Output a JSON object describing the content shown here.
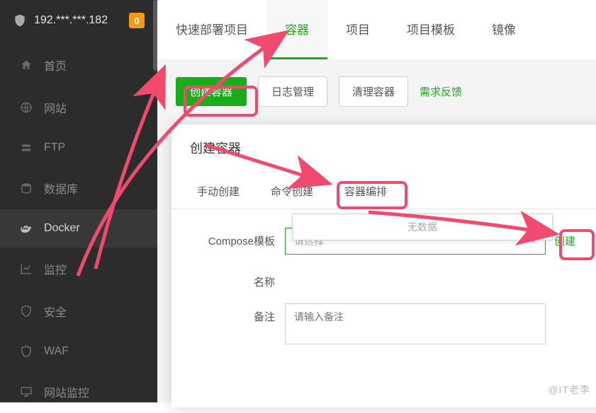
{
  "header": {
    "ip": "192.***.***.182",
    "badge": "0"
  },
  "sidebar": {
    "items": [
      {
        "label": "首页"
      },
      {
        "label": "网站"
      },
      {
        "label": "FTP"
      },
      {
        "label": "数据库"
      },
      {
        "label": "Docker"
      },
      {
        "label": "监控"
      },
      {
        "label": "安全"
      },
      {
        "label": "WAF"
      },
      {
        "label": "网站监控"
      }
    ]
  },
  "tabs": {
    "t0": "快速部署项目",
    "t1": "容器",
    "t2": "项目",
    "t3": "项目模板",
    "t4": "镜像"
  },
  "buttons": {
    "create": "创建容器",
    "log": "日志管理",
    "clean": "清理容器",
    "feedback": "需求反馈"
  },
  "dialog": {
    "title": "创建容器",
    "tabs": {
      "t0": "手动创建",
      "t1": "命令创建",
      "t2": "容器编排"
    },
    "labels": {
      "compose": "Compose模板",
      "name": "名称",
      "remark": "备注"
    },
    "select_placeholder": "请选择",
    "create_link": "创建",
    "no_data": "无数据",
    "remark_placeholder": "请输入备注"
  },
  "watermark": "@IT老李"
}
